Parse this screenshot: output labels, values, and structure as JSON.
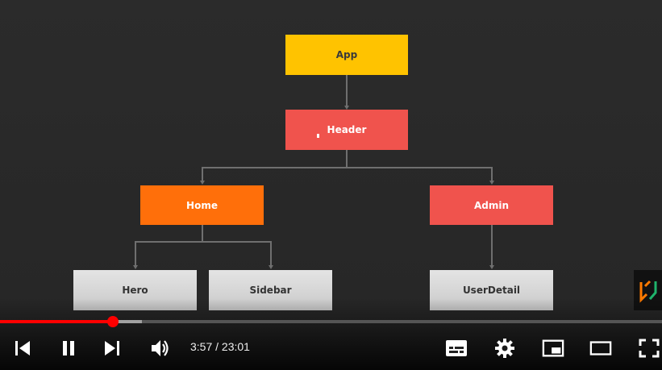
{
  "diagram": {
    "nodes": [
      {
        "id": "app",
        "label": "App",
        "color": "#ffc300"
      },
      {
        "id": "header",
        "label": "Header",
        "color": "#f0534d"
      },
      {
        "id": "home",
        "label": "Home",
        "color": "#ff6f0a"
      },
      {
        "id": "admin",
        "label": "Admin",
        "color": "#f0534d"
      },
      {
        "id": "hero",
        "label": "Hero",
        "color": "#d7d7d7"
      },
      {
        "id": "sidebar",
        "label": "Sidebar",
        "color": "#d7d7d7"
      },
      {
        "id": "userdetail",
        "label": "UserDetail",
        "color": "#d7d7d7"
      }
    ],
    "edges": [
      {
        "from": "app",
        "to": "header"
      },
      {
        "from": "header",
        "to": "home"
      },
      {
        "from": "header",
        "to": "admin"
      },
      {
        "from": "home",
        "to": "hero"
      },
      {
        "from": "home",
        "to": "sidebar"
      },
      {
        "from": "admin",
        "to": "userdetail"
      }
    ]
  },
  "player": {
    "current_time": "3:57",
    "duration": "23:01",
    "time_display": "3:57 / 23:01",
    "played_fraction": 0.171,
    "buffered_fraction": 0.214,
    "accent_color": "#ff0000",
    "controls": [
      {
        "name": "previous-icon",
        "state": ""
      },
      {
        "name": "pause-icon",
        "state": "playing"
      },
      {
        "name": "next-icon",
        "state": ""
      },
      {
        "name": "volume-icon",
        "state": "on"
      },
      {
        "name": "subtitles-icon",
        "state": ""
      },
      {
        "name": "settings-gear-icon",
        "state": ""
      },
      {
        "name": "miniplayer-icon",
        "state": ""
      },
      {
        "name": "theater-mode-icon",
        "state": ""
      },
      {
        "name": "fullscreen-icon",
        "state": ""
      }
    ]
  }
}
